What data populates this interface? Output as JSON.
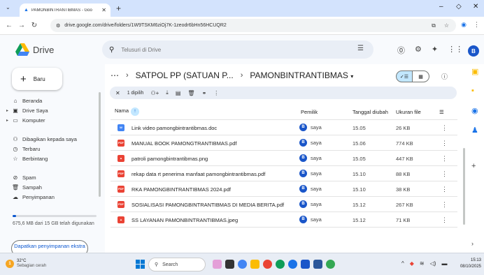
{
  "browser": {
    "tab_title": "PAMONBINTRANTIBMAS - Goo",
    "url": "drive.google.com/drive/folders/1W9TSKM6ziOj7K-1zeodr6bHn56HCUQR2"
  },
  "drive": {
    "logo_text": "Drive",
    "search_placeholder": "Telusuri di Drive",
    "avatar_letter": "B"
  },
  "sidebar": {
    "new_label": "Baru",
    "items": [
      {
        "label": "Beranda",
        "icon": "home-icon"
      },
      {
        "label": "Drive Saya",
        "icon": "my-drive-icon"
      },
      {
        "label": "Komputer",
        "icon": "computer-icon"
      },
      {
        "label": "Dibagikan kepada saya",
        "icon": "shared-icon"
      },
      {
        "label": "Terbaru",
        "icon": "clock-icon"
      },
      {
        "label": "Berbintang",
        "icon": "star-icon"
      },
      {
        "label": "Spam",
        "icon": "spam-icon"
      },
      {
        "label": "Sampah",
        "icon": "trash-icon"
      },
      {
        "label": "Penyimpanan",
        "icon": "cloud-icon"
      }
    ],
    "storage_text": "675,6 MB dari 15 GB telah digunakan",
    "storage_fraction": 0.045,
    "get_storage_label": "Dapatkan penyimpanan ekstra"
  },
  "main": {
    "breadcrumb_parent": "SATPOL PP (SATUAN P...",
    "breadcrumb_current": "PAMONBINTRANTIBMAS",
    "selection_text": "1 dipilih",
    "columns": {
      "name": "Nama",
      "owner": "Pemilik",
      "modified": "Tanggal diubah",
      "size": "Ukuran file"
    },
    "files": [
      {
        "name": "Link video pamongbintrantibmas.doc",
        "type": "doc",
        "owner": "saya",
        "date": "15.05",
        "size": "26 KB"
      },
      {
        "name": "MANUAL BOOK PAMONGTRANTIBMAS.pdf",
        "type": "pdf",
        "owner": "saya",
        "date": "15.06",
        "size": "774 KB"
      },
      {
        "name": "patroli pamongbintrantibmas.png",
        "type": "img",
        "owner": "saya",
        "date": "15.05",
        "size": "447 KB"
      },
      {
        "name": "rekap data rt penerima manfaat pamongbintrantibmas.pdf",
        "type": "pdf",
        "owner": "saya",
        "date": "15.10",
        "size": "88 KB"
      },
      {
        "name": "RKA PAMONGBINTRANTIBMAS 2024.pdf",
        "type": "pdf",
        "owner": "saya",
        "date": "15.10",
        "size": "38 KB"
      },
      {
        "name": "SOSIALISASI PAMONGBINTRANTIBMAS DI MEDIA BERITA.pdf",
        "type": "pdf",
        "owner": "saya",
        "date": "15.12",
        "size": "267 KB"
      },
      {
        "name": "SS LAYANAN PAMONBINTRANTIBMAS.jpeg",
        "type": "img",
        "owner": "saya",
        "date": "15.12",
        "size": "71 KB"
      }
    ]
  },
  "taskbar": {
    "temperature": "32°C",
    "weather": "Sebagian cerah",
    "search_label": "Search",
    "time": "15:13",
    "date": "08/10/2025"
  },
  "colors": {
    "doc": "#4285f4",
    "pdf": "#ea4335",
    "img": "#ea4335",
    "accent": "#0b57d0"
  }
}
